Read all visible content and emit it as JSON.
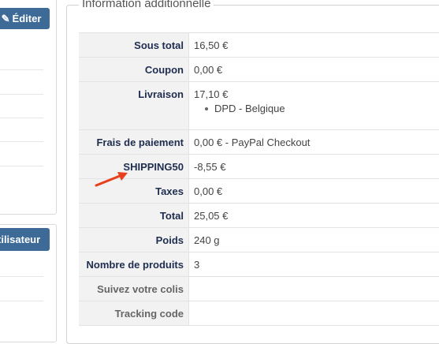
{
  "left": {
    "edit_label": "Éditer",
    "user_label": "tilisateur"
  },
  "info": {
    "title": "Information additionnelle",
    "rows": [
      {
        "label": "Sous total",
        "value": "16,50 €"
      },
      {
        "label": "Coupon",
        "value": "0,00 €"
      },
      {
        "label": "Livraison",
        "value": "17,10 €",
        "sub": "DPD - Belgique"
      },
      {
        "label": "Frais de paiement",
        "value": "0,00 € - PayPal Checkout"
      },
      {
        "label": "SHIPPING50",
        "value": "-8,55 €"
      },
      {
        "label": "Taxes",
        "value": "0,00 €"
      },
      {
        "label": "Total",
        "value": "25,05 €"
      },
      {
        "label": "Poids",
        "value": "240 g"
      },
      {
        "label": "Nombre de produits",
        "value": "3"
      },
      {
        "label": "Suivez votre colis",
        "value": ""
      },
      {
        "label": "Tracking code",
        "value": ""
      }
    ]
  },
  "colors": {
    "button": "#3d6a96",
    "label_text": "#1f2d4f",
    "label_bg": "#f2f2f2",
    "arrow": "#e8401c"
  }
}
